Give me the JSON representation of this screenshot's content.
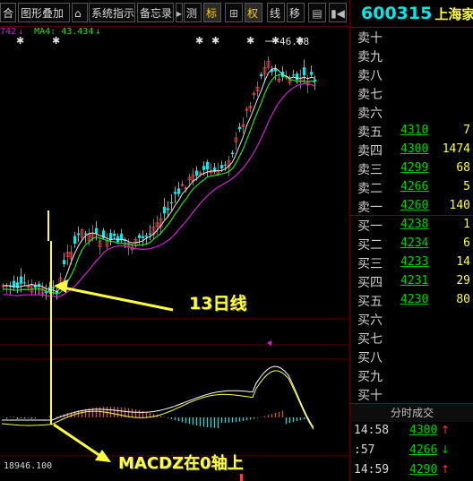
{
  "toolbar": {
    "items": [
      {
        "label": "合",
        "name": "toolbar-partial-button"
      },
      {
        "label": "图形叠加",
        "name": "graph-overlay-button"
      },
      {
        "label": "系统指示",
        "name": "system-indicator-button"
      },
      {
        "label": "备忘录",
        "name": "memo-button"
      },
      {
        "label": "测",
        "name": "measure-button"
      },
      {
        "label": "标",
        "name": "mark-button"
      },
      {
        "label": "⊞",
        "name": "grid-icon"
      },
      {
        "label": "权",
        "name": "rights-button"
      },
      {
        "label": "线",
        "name": "line-button"
      },
      {
        "label": "移",
        "name": "move-button"
      },
      {
        "label": "▤",
        "name": "window-icon"
      },
      {
        "label": "▮◀",
        "name": "panel-toggle-icon"
      }
    ]
  },
  "legend": {
    "ma_partial": "742",
    "ma_partial_arrow": "↓",
    "ma4": "MA4: 43.434",
    "ma4_arrow": "↓"
  },
  "price_label": "46.08",
  "volume_readout": "18946.100",
  "annotations": {
    "ma13": "13日线",
    "macd": "MACDZ在0轴上"
  },
  "stock": {
    "code": "600315",
    "name": "上海家化"
  },
  "orderbook": {
    "sell": [
      {
        "label": "卖十",
        "price": "",
        "vol": ""
      },
      {
        "label": "卖九",
        "price": "",
        "vol": ""
      },
      {
        "label": "卖八",
        "price": "",
        "vol": ""
      },
      {
        "label": "卖七",
        "price": "",
        "vol": ""
      },
      {
        "label": "卖六",
        "price": "",
        "vol": ""
      },
      {
        "label": "卖五",
        "price": "4310",
        "vol": "7"
      },
      {
        "label": "卖四",
        "price": "4300",
        "vol": "1474"
      },
      {
        "label": "卖三",
        "price": "4299",
        "vol": "68"
      },
      {
        "label": "卖二",
        "price": "4266",
        "vol": "5"
      },
      {
        "label": "卖一",
        "price": "4260",
        "vol": "140"
      }
    ],
    "buy": [
      {
        "label": "买一",
        "price": "4238",
        "vol": "1"
      },
      {
        "label": "买二",
        "price": "4234",
        "vol": "6"
      },
      {
        "label": "买三",
        "price": "4233",
        "vol": "14"
      },
      {
        "label": "买四",
        "price": "4231",
        "vol": "29"
      },
      {
        "label": "买五",
        "price": "4230",
        "vol": "80"
      },
      {
        "label": "买六",
        "price": "",
        "vol": ""
      },
      {
        "label": "买七",
        "price": "",
        "vol": ""
      },
      {
        "label": "买八",
        "price": "",
        "vol": ""
      },
      {
        "label": "买九",
        "price": "",
        "vol": ""
      },
      {
        "label": "买十",
        "price": "",
        "vol": ""
      }
    ]
  },
  "trades": {
    "header": "分时成交",
    "rows": [
      {
        "time": "14:58",
        "price": "4300",
        "arrow": "↑",
        "dir": "up"
      },
      {
        "time": ":57",
        "price": "4266",
        "arrow": "↓",
        "dir": "down"
      },
      {
        "time": "14:59",
        "price": "4290",
        "arrow": "↑",
        "dir": "up"
      }
    ]
  },
  "colors": {
    "up": "#ff3a3a",
    "down": "#00e8e8",
    "ma_yellow": "#ffff40",
    "ma_purple": "#d020d0",
    "ma_green": "#20e020",
    "annotation": "#ffff40"
  }
}
